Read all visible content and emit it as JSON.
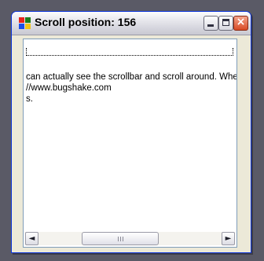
{
  "window": {
    "title": "Scroll position: 156",
    "icon": "app-icon",
    "controls": [
      "minimize-icon",
      "maximize-icon",
      "close-icon"
    ],
    "close_glyph": "×"
  },
  "content": {
    "lines": [
      " can actually see the scrollbar and scroll around. When y",
      "//www.bugshake.com",
      "s."
    ]
  },
  "scrollbar": {
    "left_arrow": "◄",
    "right_arrow": "►",
    "position": 156
  }
}
